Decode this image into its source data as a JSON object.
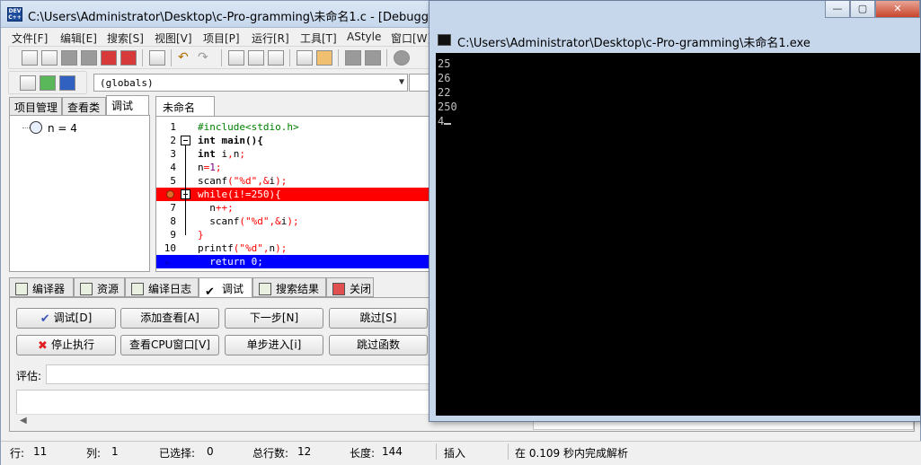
{
  "main": {
    "title": "C:\\Users\\Administrator\\Desktop\\c-Pro-gramming\\未命名1.c - [Debugging] - Dev-C++ 5.11",
    "app_icon": "DEV C++"
  },
  "menu": [
    "文件[F]",
    "编辑[E]",
    "搜索[S]",
    "视图[V]",
    "项目[P]",
    "运行[R]",
    "工具[T]",
    "AStyle",
    "窗口[W]"
  ],
  "toolbar": {
    "scope_value": "(globals)"
  },
  "left_tabs": [
    "项目管理",
    "查看类",
    "调试"
  ],
  "watch": {
    "expression": "n = 4"
  },
  "editor": {
    "tab": "未命名1.c",
    "lines": [
      {
        "no": "1",
        "segments": [
          {
            "t": "#include<stdio.h>",
            "c": "c-pre"
          }
        ]
      },
      {
        "no": "2",
        "segments": [
          {
            "t": "int ",
            "c": "c-kw"
          },
          {
            "t": "main",
            "c": "c-kw"
          },
          {
            "t": "(){",
            "c": "c-kw"
          }
        ]
      },
      {
        "no": "3",
        "segments": [
          {
            "t": "int ",
            "c": "c-kw"
          },
          {
            "t": "i",
            "c": ""
          },
          {
            "t": ",",
            "c": "c-sym"
          },
          {
            "t": "n",
            "c": ""
          },
          {
            "t": ";",
            "c": "c-sym"
          }
        ]
      },
      {
        "no": "4",
        "segments": [
          {
            "t": "n",
            "c": ""
          },
          {
            "t": "=",
            "c": "c-sym"
          },
          {
            "t": "1",
            "c": "c-num"
          },
          {
            "t": ";",
            "c": "c-sym"
          }
        ]
      },
      {
        "no": "5",
        "segments": [
          {
            "t": "scanf",
            "c": ""
          },
          {
            "t": "(",
            "c": "c-sym"
          },
          {
            "t": "\"%d\"",
            "c": "c-str"
          },
          {
            "t": ",&",
            "c": "c-sym"
          },
          {
            "t": "i",
            "c": ""
          },
          {
            "t": ");",
            "c": "c-sym"
          }
        ]
      },
      {
        "no": "6",
        "segments": [
          {
            "t": "while(i!=250){",
            "c": ""
          }
        ]
      },
      {
        "no": "7",
        "segments": [
          {
            "t": "  n",
            "c": ""
          },
          {
            "t": "++;",
            "c": "c-sym"
          }
        ]
      },
      {
        "no": "8",
        "segments": [
          {
            "t": "  scanf",
            "c": ""
          },
          {
            "t": "(",
            "c": "c-sym"
          },
          {
            "t": "\"%d\"",
            "c": "c-str"
          },
          {
            "t": ",&",
            "c": "c-sym"
          },
          {
            "t": "i",
            "c": ""
          },
          {
            "t": ");",
            "c": "c-sym"
          }
        ]
      },
      {
        "no": "9",
        "segments": [
          {
            "t": "}",
            "c": "c-sym"
          }
        ]
      },
      {
        "no": "10",
        "segments": [
          {
            "t": "printf",
            "c": ""
          },
          {
            "t": "(",
            "c": "c-sym"
          },
          {
            "t": "\"%d\"",
            "c": "c-str"
          },
          {
            "t": ",",
            "c": "c-sym"
          },
          {
            "t": "n",
            "c": ""
          },
          {
            "t": ");",
            "c": "c-sym"
          }
        ]
      },
      {
        "no": "11",
        "segments": [
          {
            "t": "  return 0;",
            "c": ""
          }
        ]
      }
    ]
  },
  "bottom_tabs": [
    "编译器",
    "资源",
    "编译日志",
    "调试",
    "搜索结果",
    "关闭"
  ],
  "debug_buttons": {
    "debug": "调试[D]",
    "add_watch": "添加查看[A]",
    "next_step": "下一步[N]",
    "skip": "跳过[S]",
    "stop": "停止执行",
    "cpu_window": "查看CPU窗口[V]",
    "step_into": "单步进入[i]",
    "skip_function": "跳过函数"
  },
  "evaluate": {
    "label": "评估:"
  },
  "status": {
    "row_label": "行:",
    "row": "11",
    "col_label": "列:",
    "col": "1",
    "selected_label": "已选择:",
    "selected": "0",
    "total_label": "总行数:",
    "total": "12",
    "length_label": "长度:",
    "length": "144",
    "mode": "插入",
    "parse_msg": "在 0.109 秒内完成解析"
  },
  "console": {
    "title": "C:\\Users\\Administrator\\Desktop\\c-Pro-gramming\\未命名1.exe",
    "lines": [
      "25",
      "26",
      "22",
      "250",
      "4"
    ],
    "btn_min": "—",
    "btn_max": "▢",
    "btn_close": "✕"
  }
}
